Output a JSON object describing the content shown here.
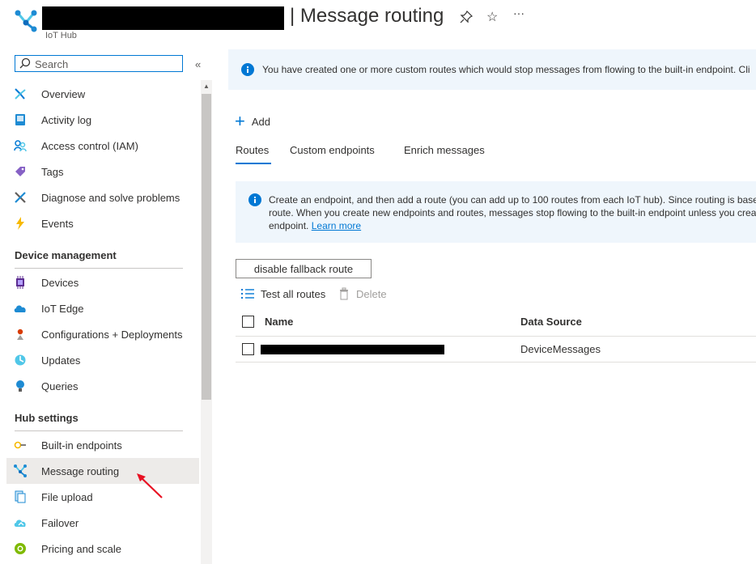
{
  "header": {
    "title": "| Message routing",
    "subtitle": "IoT Hub",
    "pin_icon": "pin-icon",
    "favorite_icon": "star-icon",
    "more_label": "···"
  },
  "sidebar": {
    "search_placeholder": "Search",
    "collapse_label": "«",
    "items_top": [
      {
        "label": "Overview",
        "icon": "overview-icon"
      },
      {
        "label": "Activity log",
        "icon": "activity-log-icon"
      },
      {
        "label": "Access control (IAM)",
        "icon": "iam-icon"
      },
      {
        "label": "Tags",
        "icon": "tag-icon"
      },
      {
        "label": "Diagnose and solve problems",
        "icon": "wrench-icon"
      },
      {
        "label": "Events",
        "icon": "lightning-icon"
      }
    ],
    "device_management": {
      "heading": "Device management",
      "items": [
        {
          "label": "Devices",
          "icon": "chip-icon"
        },
        {
          "label": "IoT Edge",
          "icon": "cloud-icon"
        },
        {
          "label": "Configurations + Deployments",
          "icon": "config-icon"
        },
        {
          "label": "Updates",
          "icon": "updates-icon"
        },
        {
          "label": "Queries",
          "icon": "bulb-icon"
        }
      ]
    },
    "hub_settings": {
      "heading": "Hub settings",
      "items": [
        {
          "label": "Built-in endpoints",
          "icon": "endpoint-icon"
        },
        {
          "label": "Message routing",
          "icon": "routing-icon",
          "selected": true
        },
        {
          "label": "File upload",
          "icon": "file-upload-icon"
        },
        {
          "label": "Failover",
          "icon": "failover-icon"
        },
        {
          "label": "Pricing and scale",
          "icon": "pricing-icon"
        }
      ]
    }
  },
  "main": {
    "banner_top": "You have created one or more custom routes which would stop messages from flowing to the built-in endpoint.  Cli",
    "add_label": "Add",
    "tabs": [
      "Routes",
      "Custom endpoints",
      "Enrich messages"
    ],
    "active_tab": 0,
    "info_banner": {
      "line1": "Create an endpoint, and then add a route (you can add up to 100 routes from each IoT hub). Since routing is base",
      "line2": "route. When you create new endpoints and routes, messages stop flowing to the built-in endpoint unless you crea",
      "line3": "endpoint.",
      "link": "Learn more"
    },
    "fallback_button": "disable fallback route",
    "toolbar": {
      "test_label": "Test all routes",
      "delete_label": "Delete"
    },
    "table": {
      "columns": [
        "Name",
        "Data Source"
      ],
      "rows": [
        {
          "name": "",
          "data_source": "DeviceMessages"
        }
      ]
    }
  },
  "colors": {
    "accent": "#0078d4",
    "banner_bg": "#eff6fc",
    "selected_bg": "#edebe9",
    "annotation_arrow": "#e81123"
  }
}
